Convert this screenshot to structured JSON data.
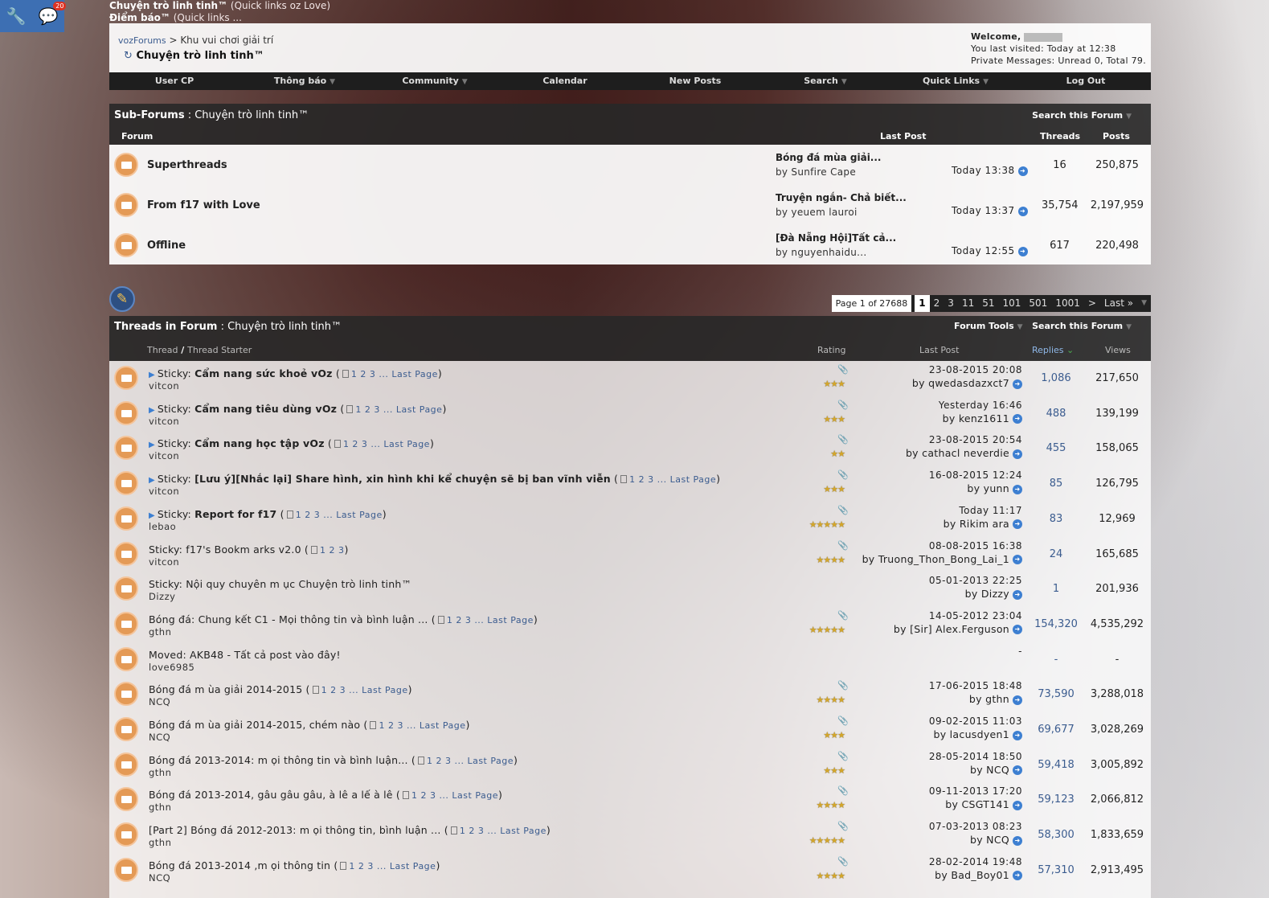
{
  "topbar": {
    "badge_count": "20",
    "line1_bold": "Chuyện trò linh tinh™",
    "line1_rest": " (Quick links oz Love)",
    "line2_bold": "Điểm báo™",
    "line2_rest": " (Quick links ..."
  },
  "header": {
    "breadcrumb_link": "vozForums",
    "breadcrumb_sep": " > ",
    "breadcrumb_parent": "Khu vui chơi giải trí",
    "page_title": "Chuyện trò linh tinh™",
    "welcome_label": "Welcome,",
    "last_visited": "You last visited: Today at 12:38",
    "private_messages": "Private Messages: Unread 0, Total 79."
  },
  "navbar": {
    "items": [
      "User CP",
      "Thông báo",
      "Community",
      "Calendar",
      "New Posts",
      "Search",
      "Quick Links",
      "Log Out"
    ]
  },
  "subforums": {
    "title_label": "Sub-Forums",
    "title_name": " : Chuyện trò linh tinh™",
    "search_label": "Search this Forum",
    "col_forum": "Forum",
    "col_last_post": "Last Post",
    "col_threads": "Threads",
    "col_posts": "Posts",
    "rows": [
      {
        "name": "Superthreads",
        "lp_title": "Bóng đá mùa giải...",
        "lp_by": "by Sunfire Cape",
        "lp_time": "Today 13:38",
        "threads": "16",
        "posts": "250,875"
      },
      {
        "name": "From f17 with Love",
        "lp_title": "Truyện ngắn- Chả biết...",
        "lp_by": "by yeuem lauroi",
        "lp_time": "Today 13:37",
        "threads": "35,754",
        "posts": "2,197,959"
      },
      {
        "name": "Offline",
        "lp_title": "[Đà Nẵng Hội]Tất cả...",
        "lp_by": "by nguyenhaidu...",
        "lp_time": "Today 12:55",
        "threads": "617",
        "posts": "220,498"
      }
    ]
  },
  "pagination": {
    "label": "Page 1 of 27688",
    "pages": [
      "1",
      "2",
      "3",
      "11",
      "51",
      "101",
      "501",
      "1001",
      ">",
      "Last »"
    ]
  },
  "threads": {
    "title_label": "Threads in Forum",
    "title_name": " : Chuyện trò linh tinh™",
    "forum_tools": "Forum Tools",
    "search_label": "Search this Forum",
    "col_thread": "Thread",
    "col_sep": " / ",
    "col_starter": "Thread Starter",
    "col_rating": "Rating",
    "col_last_post": "Last Post",
    "col_replies": "Replies",
    "col_views": "Views",
    "rows": [
      {
        "prefix": "Sticky: ",
        "title": "Cẩm nang sức khoẻ vOz",
        "pages": "1 2 3 ... Last Page",
        "starter": "vitcon",
        "stars": "★★★",
        "lp_time": "23-08-2015 20:08",
        "lp_by": "by qwedasdazxct7",
        "replies": "1,086",
        "views": "217,650"
      },
      {
        "prefix": "Sticky: ",
        "title": "Cẩm nang tiêu dùng vOz",
        "pages": "1 2 3 ... Last Page",
        "starter": "vitcon",
        "stars": "★★★",
        "lp_time": "Yesterday 16:46",
        "lp_by": "by kenz1611",
        "replies": "488",
        "views": "139,199"
      },
      {
        "prefix": "Sticky: ",
        "title": "Cẩm nang học tập vOz",
        "pages": "1 2 3 ... Last Page",
        "starter": "vitcon",
        "stars": "★★",
        "lp_time": "23-08-2015 20:54",
        "lp_by": "by cathacl neverdie",
        "replies": "455",
        "views": "158,065"
      },
      {
        "prefix": "Sticky: ",
        "title": "[Lưu ý][Nhắc lại] Share hình, xin hình khi kể chuyện sẽ bị ban vĩnh viễn",
        "pages": "1 2 3 ... Last Page",
        "starter": "vitcon",
        "stars": "★★★",
        "lp_time": "16-08-2015 12:24",
        "lp_by": "by yunn",
        "replies": "85",
        "views": "126,795"
      },
      {
        "prefix": "Sticky: ",
        "title": "Report for f17",
        "pages": "1 2 3 ... Last Page",
        "starter": "lebao",
        "stars": "★★★★★",
        "lp_time": "Today 11:17",
        "lp_by": "by Rikim ara",
        "replies": "83",
        "views": "12,969"
      },
      {
        "prefix": "Sticky: ",
        "title": "f17's Bookm arks v2.0",
        "pages": "1 2 3",
        "starter": "vitcon",
        "stars": "★★★★",
        "lp_time": "08-08-2015 16:38",
        "lp_by": "by Truong_Thon_Bong_Lai_1",
        "replies": "24",
        "views": "165,685"
      },
      {
        "prefix": "Sticky: ",
        "title": "Nội quy chuyên m ục Chuyện trò linh tinh™",
        "pages": "",
        "starter": "Dizzy",
        "stars": "",
        "lp_time": "05-01-2013 22:25",
        "lp_by": "by Dizzy",
        "replies": "1",
        "views": "201,936"
      },
      {
        "prefix": "",
        "title": "Bóng đá: Chung kết C1 - Mọi thông tin và bình luận ...",
        "pages": "1 2 3 ... Last Page",
        "starter": "gthn",
        "stars": "★★★★★",
        "lp_time": "14-05-2012 23:04",
        "lp_by": "by [Sir] Alex.Ferguson",
        "replies": "154,320",
        "views": "4,535,292"
      },
      {
        "prefix": "Moved: ",
        "title": "AKB48 - Tất cả post vào đây!",
        "pages": "",
        "starter": "love6985",
        "stars": "",
        "lp_time": "-",
        "lp_by": "",
        "replies": "-",
        "views": "-"
      },
      {
        "prefix": "",
        "title": "Bóng đá m ùa giải 2014-2015",
        "pages": "1 2 3 ... Last Page",
        "starter": "NCQ",
        "stars": "★★★★",
        "lp_time": "17-06-2015 18:48",
        "lp_by": "by gthn",
        "replies": "73,590",
        "views": "3,288,018"
      },
      {
        "prefix": "",
        "title": "Bóng đá m ùa giải 2014-2015, chém nào",
        "pages": "1 2 3 ... Last Page",
        "starter": "NCQ",
        "stars": "★★★",
        "lp_time": "09-02-2015 11:03",
        "lp_by": "by lacusdyen1",
        "replies": "69,677",
        "views": "3,028,269"
      },
      {
        "prefix": "",
        "title": "Bóng đá 2013-2014: m ọi thông tin và bình luận...",
        "pages": "1 2 3 ... Last Page",
        "starter": "gthn",
        "stars": "★★★",
        "lp_time": "28-05-2014 18:50",
        "lp_by": "by NCQ",
        "replies": "59,418",
        "views": "3,005,892"
      },
      {
        "prefix": "",
        "title": "Bóng đá 2013-2014, gâu gâu gâu, à lê a lế à lê",
        "pages": "1 2 3 ... Last Page",
        "starter": "gthn",
        "stars": "★★★★",
        "lp_time": "09-11-2013 17:20",
        "lp_by": "by CSGT141",
        "replies": "59,123",
        "views": "2,066,812"
      },
      {
        "prefix": "",
        "title": "[Part 2] Bóng đá 2012-2013: m ọi thông tin, bình luận ...",
        "pages": "1 2 3 ... Last Page",
        "starter": "gthn",
        "stars": "★★★★★",
        "lp_time": "07-03-2013 08:23",
        "lp_by": "by NCQ",
        "replies": "58,300",
        "views": "1,833,659"
      },
      {
        "prefix": "",
        "title": "Bóng đá 2013-2014 ,m ọi thông tin",
        "pages": "1 2 3 ... Last Page",
        "starter": "NCQ",
        "stars": "★★★★",
        "lp_time": "28-02-2014 19:48",
        "lp_by": "by Bad_Boy01",
        "replies": "57,310",
        "views": "2,913,495"
      }
    ]
  }
}
